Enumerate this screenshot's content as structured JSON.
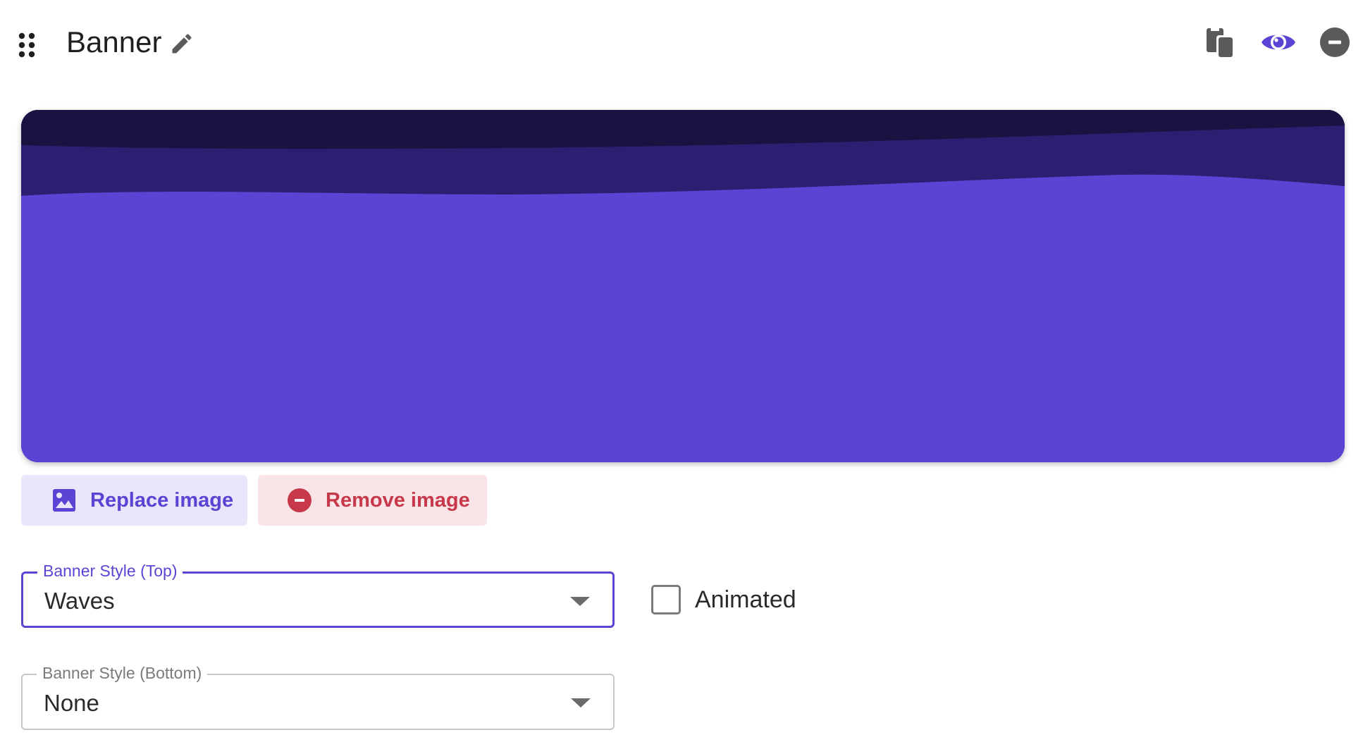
{
  "header": {
    "title": "Banner",
    "icons": {
      "drag": "drag-handle-icon",
      "edit": "pencil-icon",
      "copy": "copy-icon",
      "visibility": "eye-icon",
      "remove": "remove-circle-icon"
    }
  },
  "banner": {
    "style_top": "Waves",
    "colors": {
      "base": "#5b44d4",
      "wave_dark": "#1a1240",
      "wave_mid": "#2b1f72",
      "wave_light": "#3a2a8a"
    }
  },
  "actions": {
    "replace_label": "Replace image",
    "replace_icon": "image-icon",
    "remove_label": "Remove image",
    "remove_icon": "remove-circle-icon"
  },
  "fields": {
    "style_top": {
      "label": "Banner Style (Top)",
      "value": "Waves"
    },
    "style_bottom": {
      "label": "Banner Style (Bottom)",
      "value": "None"
    }
  },
  "animated": {
    "label": "Animated",
    "checked": false
  },
  "colors": {
    "accent": "#5b44d4",
    "accent_bg": "#e8e6fa",
    "danger": "#c7384a",
    "danger_bg": "#f9e5e7",
    "icon_gray": "#5a5a5a"
  }
}
